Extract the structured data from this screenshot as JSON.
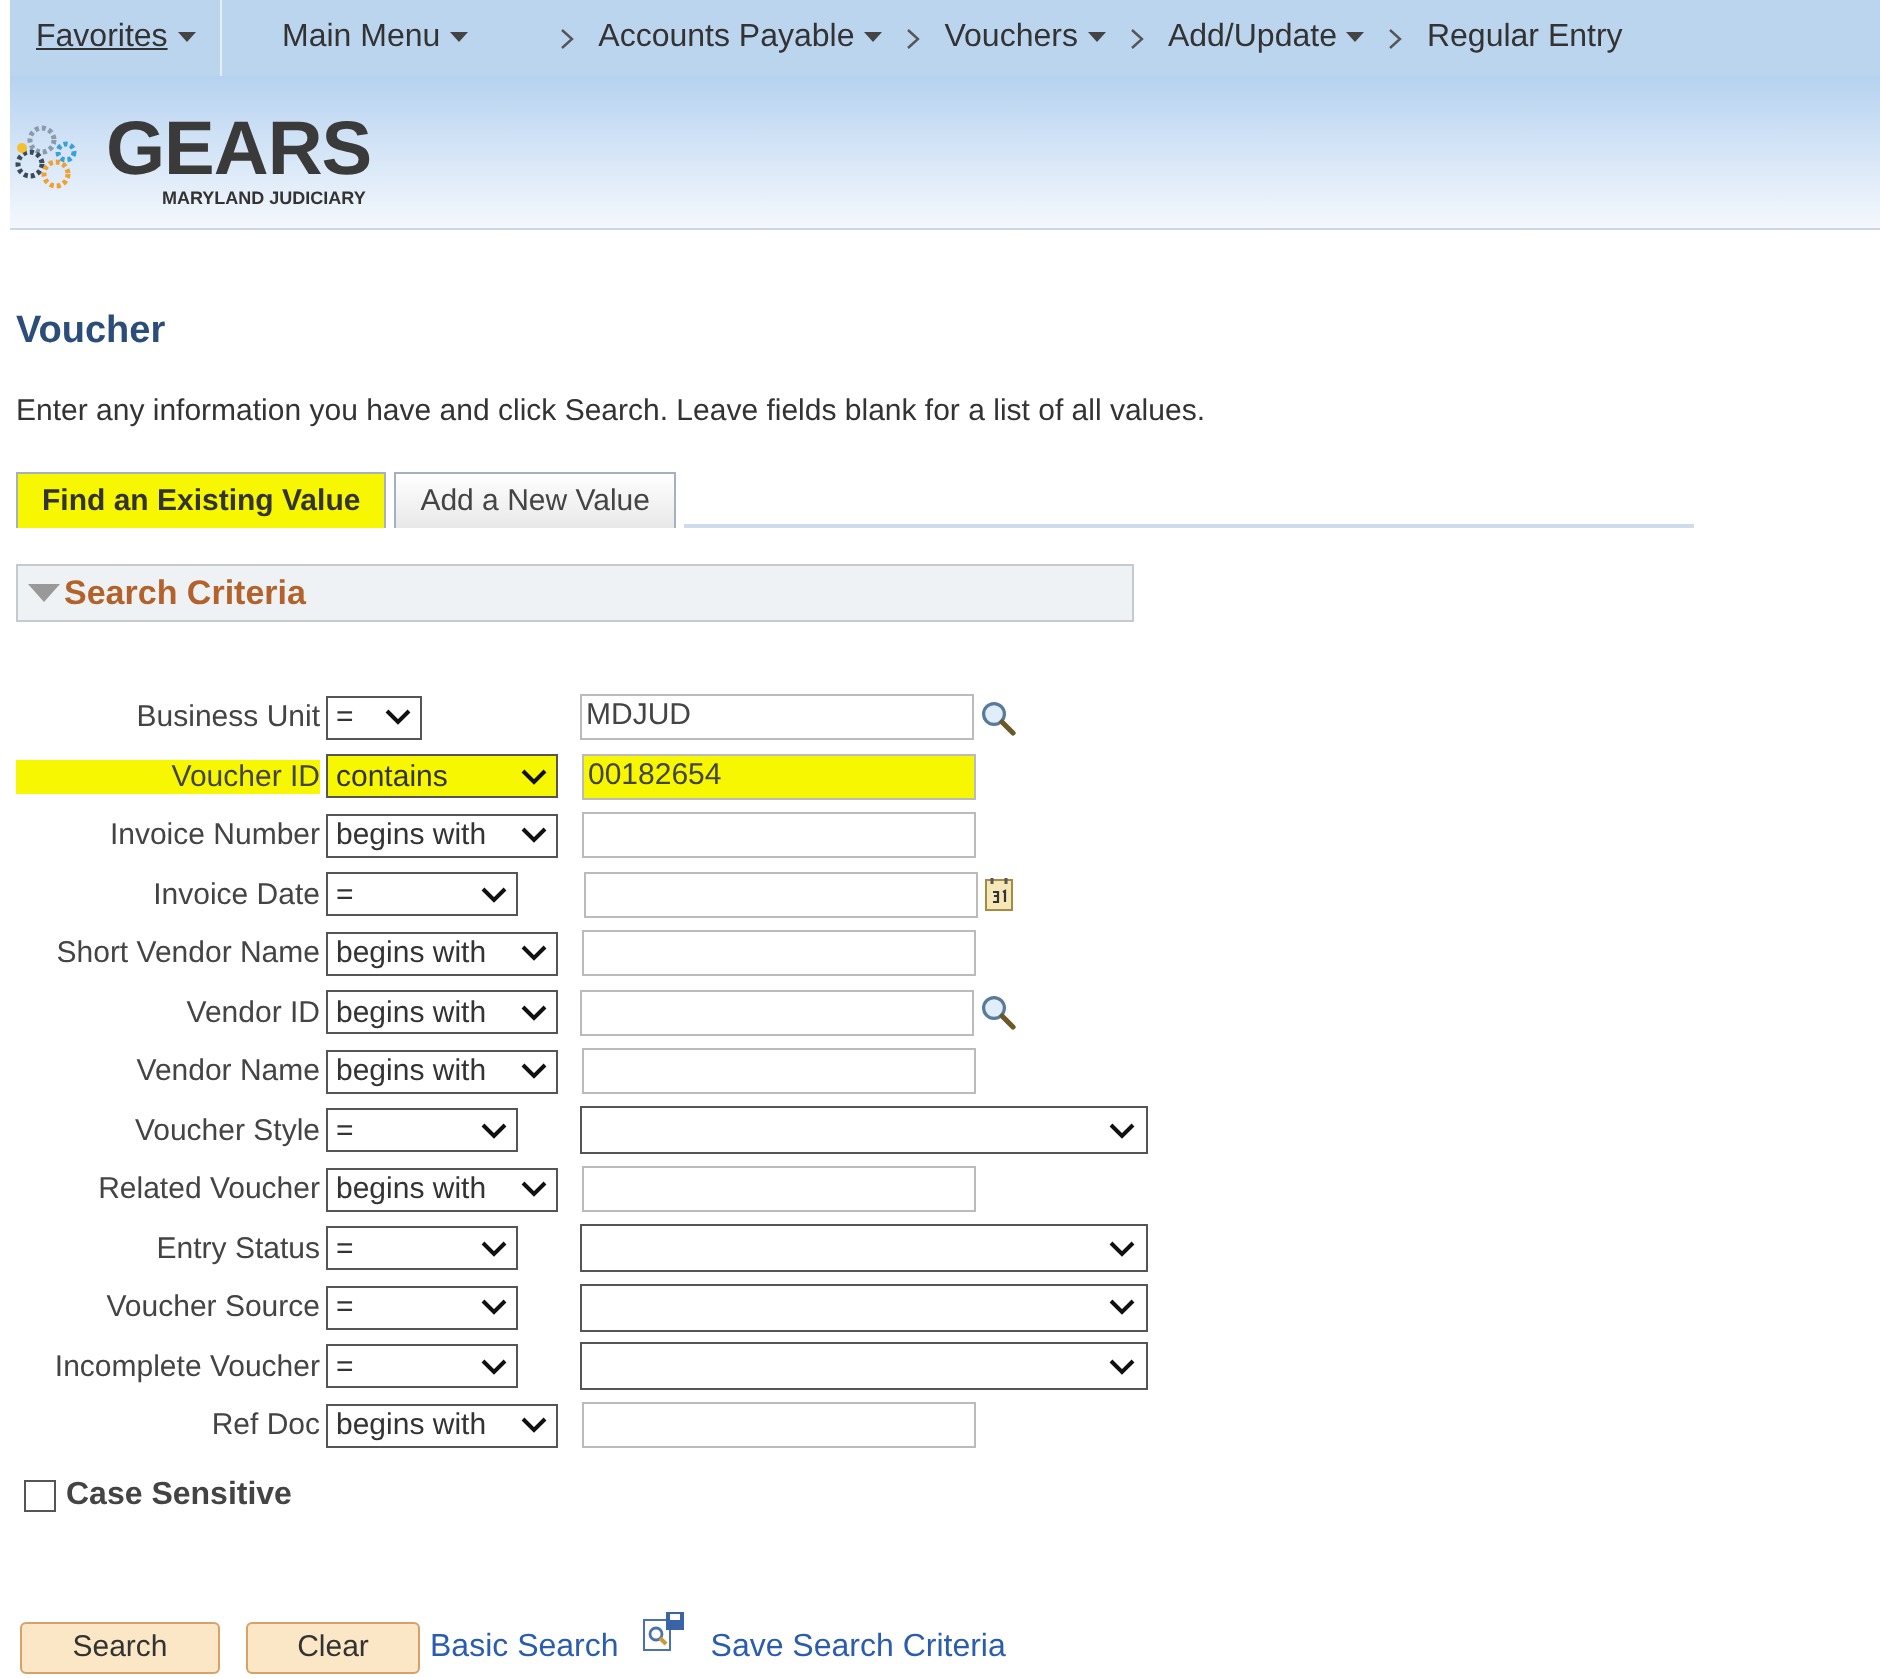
{
  "nav": {
    "favorites": "Favorites",
    "items": [
      "Main Menu",
      "Accounts Payable",
      "Vouchers",
      "Add/Update"
    ],
    "current": "Regular Entry"
  },
  "logo": {
    "name": "GEARS",
    "subtitle": "MARYLAND JUDICIARY"
  },
  "page_title": "Voucher",
  "instructions": "Enter any information you have and click Search. Leave fields blank for a list of all values.",
  "tabs": [
    {
      "label": "Find an Existing Value",
      "selected": true,
      "highlighted": true
    },
    {
      "label": "Add a New Value",
      "selected": false,
      "highlighted": false
    }
  ],
  "section": {
    "title": "Search Criteria",
    "expanded": true
  },
  "criteria": [
    {
      "label": "Business Unit",
      "operator": "=",
      "kind": "keylookup",
      "value": "MDJUD",
      "highlighted": false
    },
    {
      "label": "Voucher ID",
      "operator": "contains",
      "kind": "text",
      "value": "00182654",
      "highlighted": true
    },
    {
      "label": "Invoice Number",
      "operator": "begins with",
      "kind": "text",
      "highlighted": false
    },
    {
      "label": "Invoice Date",
      "operator": "=",
      "kind": "date",
      "highlighted": false
    },
    {
      "label": "Short Vendor Name",
      "operator": "begins with",
      "kind": "text",
      "highlighted": false
    },
    {
      "label": "Vendor ID",
      "operator": "begins with",
      "kind": "lookup",
      "highlighted": false
    },
    {
      "label": "Vendor Name",
      "operator": "begins with",
      "kind": "text",
      "highlighted": false
    },
    {
      "label": "Voucher Style",
      "operator": "=",
      "kind": "dropdown",
      "highlighted": false
    },
    {
      "label": "Related Voucher",
      "operator": "begins with",
      "kind": "text",
      "highlighted": false
    },
    {
      "label": "Entry Status",
      "operator": "=",
      "kind": "dropdown",
      "highlighted": false
    },
    {
      "label": "Voucher Source",
      "operator": "=",
      "kind": "dropdown",
      "highlighted": false
    },
    {
      "label": "Incomplete Voucher",
      "operator": "=",
      "kind": "dropdown",
      "highlighted": false
    },
    {
      "label": "Ref Doc",
      "operator": "begins with",
      "kind": "text",
      "highlighted": false
    }
  ],
  "case_sensitive": {
    "label": "Case Sensitive",
    "checked": false
  },
  "buttons": [
    "Search",
    "Clear"
  ],
  "links": [
    {
      "label": "Basic Search",
      "kind": "plain"
    },
    {
      "label": "Save Search Criteria",
      "kind": "save"
    }
  ]
}
